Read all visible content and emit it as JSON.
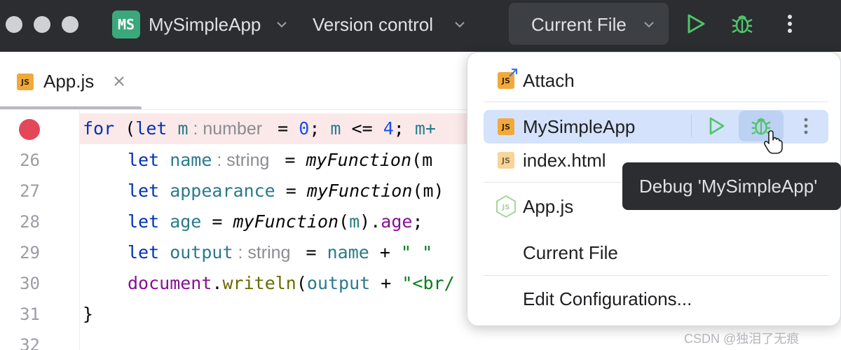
{
  "titlebar": {
    "project_badge": "MS",
    "project_name": "MySimpleApp",
    "vcs_label": "Version control",
    "run_config": "Current File",
    "icons": [
      "chevron-down-icon",
      "run-icon",
      "debug-icon",
      "more-vertical-icon"
    ]
  },
  "editor": {
    "tab": {
      "icon": "JS",
      "label": "App.js"
    },
    "gutter": [
      "26",
      "27",
      "28",
      "29",
      "30",
      "31",
      "32"
    ],
    "code": {
      "l25": {
        "t1": "for",
        "t2": " (",
        "t3": "let",
        "t4": " m",
        "hint": " : number ",
        "t5": " = ",
        "t6": "0",
        "t7": "; ",
        "t8": "m",
        "t9": " <= ",
        "t10": "4",
        "t11": "; ",
        "t12": "m+"
      },
      "l26": {
        "t1": "let",
        "t2": " name",
        "hint": " : string ",
        "t3": " = ",
        "t4": "myFunction",
        "t5": "(m"
      },
      "l27": {
        "t1": "let",
        "t2": " appearance",
        "t3": " = ",
        "t4": "myFunction",
        "t5": "(m)"
      },
      "l28": {
        "t1": "let",
        "t2": " age",
        "t3": " = ",
        "t4": "myFunction",
        "t5": "(",
        "t6": "m",
        "t7": ").",
        "t8": "age",
        "t9": ";"
      },
      "l29": {
        "t1": "let",
        "t2": " output",
        "hint": " : string ",
        "t3": " = ",
        "t4": "name",
        "t5": " + ",
        "t6": "\" \""
      },
      "l30": {
        "t1": "document",
        "t2": ".",
        "t3": "writeln",
        "t4": "(",
        "t5": "output",
        "t6": " + ",
        "t7": "\"<br/"
      },
      "l31": {
        "t1": "}"
      }
    }
  },
  "popup": {
    "items": [
      {
        "label": "Attach",
        "icon": "JS"
      },
      {
        "label": "MySimpleApp",
        "icon": "JS",
        "selected": true
      },
      {
        "label": "index.html",
        "icon": "JS"
      },
      {
        "label": "App.js",
        "icon": "nodejs-icon"
      },
      {
        "label": "Current File"
      },
      {
        "label": "Edit Configurations..."
      }
    ],
    "tooltip": "Debug 'MySimpleApp'"
  },
  "watermark": "CSDN @独泪了无痕",
  "colors": {
    "titlebar_bg": "#2b2d30",
    "accent_green": "#3aa87a",
    "run_green": "#4fc46a",
    "selected_bg": "#d4e2fb",
    "breakpoint_red": "#e5475a"
  }
}
